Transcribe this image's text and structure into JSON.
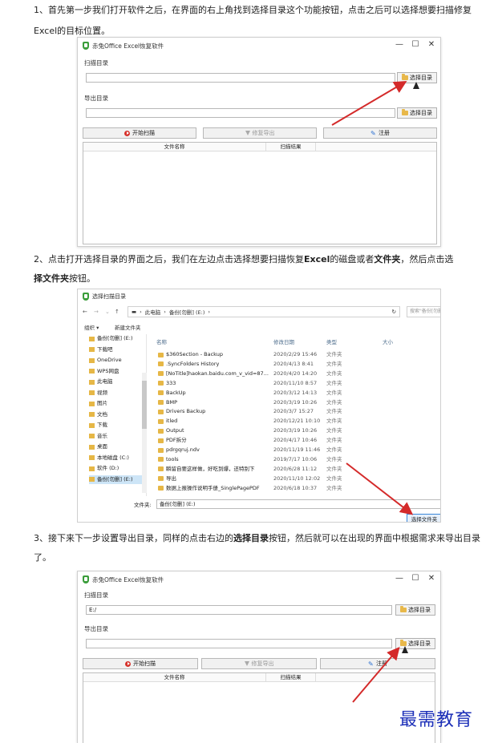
{
  "steps": {
    "s1": "1、首先第一步我们打开软件之后，在界面的右上角找到选择目录这个功能按钮，点击之后可以选择想要扫描修复Excel的目标位置。",
    "s2_a": "2、点击打开选择目录的界面之后，我们在左边点击选择想要扫描恢复",
    "s2_b": "Excel",
    "s2_c": "的磁盘或者",
    "s2_d": "文件夹",
    "s2_e": "，然后点击选",
    "s2_f": "择文件夹",
    "s2_g": "按钮。",
    "s3_a": "3、接下来下一步设置导出目录，同样的点击右边的",
    "s3_b": "选择目录",
    "s3_c": "按钮，然后就可以在出现的界面中根据需求来导出目录了。"
  },
  "app": {
    "title": "赤兔Office Excel恢复软件",
    "scan_label": "扫描目录",
    "export_label": "导出目录",
    "pick_label": "选择目录",
    "start_label": "开始扫描",
    "fix_label": "修复导出",
    "register_label": "注册",
    "col_file": "文件名称",
    "col_result": "扫描结果",
    "scan_value_3": "E:/"
  },
  "dialog": {
    "title": "选择扫描目录",
    "path_pc": "此电脑",
    "path_drive": "备份[勿删] (E:)",
    "search_placeholder": "搜索\"备份[勿删] (E:)\"",
    "organize": "组织 ▾",
    "new_folder": "新建文件夹",
    "col_name": "名称",
    "col_date": "修改日期",
    "col_type": "类型",
    "col_size": "大小",
    "tree": [
      {
        "label": "备份[勿删] (E:)"
      },
      {
        "label": "下载吧"
      },
      {
        "label": "OneDrive"
      },
      {
        "label": "WPS网盘"
      },
      {
        "label": "此电脑"
      },
      {
        "label": "视频"
      },
      {
        "label": "图片"
      },
      {
        "label": "文档"
      },
      {
        "label": "下载"
      },
      {
        "label": "音乐"
      },
      {
        "label": "桌面"
      },
      {
        "label": "本地磁盘 (C:)"
      },
      {
        "label": "软件 (D:)"
      },
      {
        "label": "备份[勿删] (E:)"
      }
    ],
    "files": [
      {
        "name": "$360Section - Backup",
        "date": "2020/2/29 15:46",
        "type": "文件夹"
      },
      {
        "name": ".SyncFolders History",
        "date": "2020/4/13 8:41",
        "type": "文件夹"
      },
      {
        "name": "[NoTitle]haokan.baidu.com_v_vid=87...",
        "date": "2020/4/20 14:20",
        "type": "文件夹"
      },
      {
        "name": "333",
        "date": "2020/11/10 8:57",
        "type": "文件夹"
      },
      {
        "name": "BackUp",
        "date": "2020/3/12 14:13",
        "type": "文件夹"
      },
      {
        "name": "BMP",
        "date": "2020/3/19 10:26",
        "type": "文件夹"
      },
      {
        "name": "Drivers Backup",
        "date": "2020/3/7 15:27",
        "type": "文件夹"
      },
      {
        "name": "itled",
        "date": "2020/12/21 10:10",
        "type": "文件夹"
      },
      {
        "name": "Output",
        "date": "2020/3/19 10:26",
        "type": "文件夹"
      },
      {
        "name": "PDF拆分",
        "date": "2020/4/17 10:46",
        "type": "文件夹"
      },
      {
        "name": "pdrgqruj.ndv",
        "date": "2020/11/19 11:46",
        "type": "文件夹"
      },
      {
        "name": "tools",
        "date": "2019/7/17 10:06",
        "type": "文件夹"
      },
      {
        "name": "瞬留自要这样做，好吃到爆，还特别下",
        "date": "2020/6/28 11:12",
        "type": "文件夹"
      },
      {
        "name": "导出",
        "date": "2020/11/10 12:02",
        "type": "文件夹"
      },
      {
        "name": "数据上报操作说明手册_SinglePagePDF",
        "date": "2020/6/18 10:37",
        "type": "文件夹"
      }
    ],
    "folder_label": "文件夹:",
    "folder_value": "备份[勿删] (E:)",
    "choose_button": "选择文件夹"
  },
  "watermark": "最需教育",
  "colors": {
    "arrow": "#d42a2a",
    "watermark": "#1c2fb8",
    "folder": "#e6b746"
  }
}
